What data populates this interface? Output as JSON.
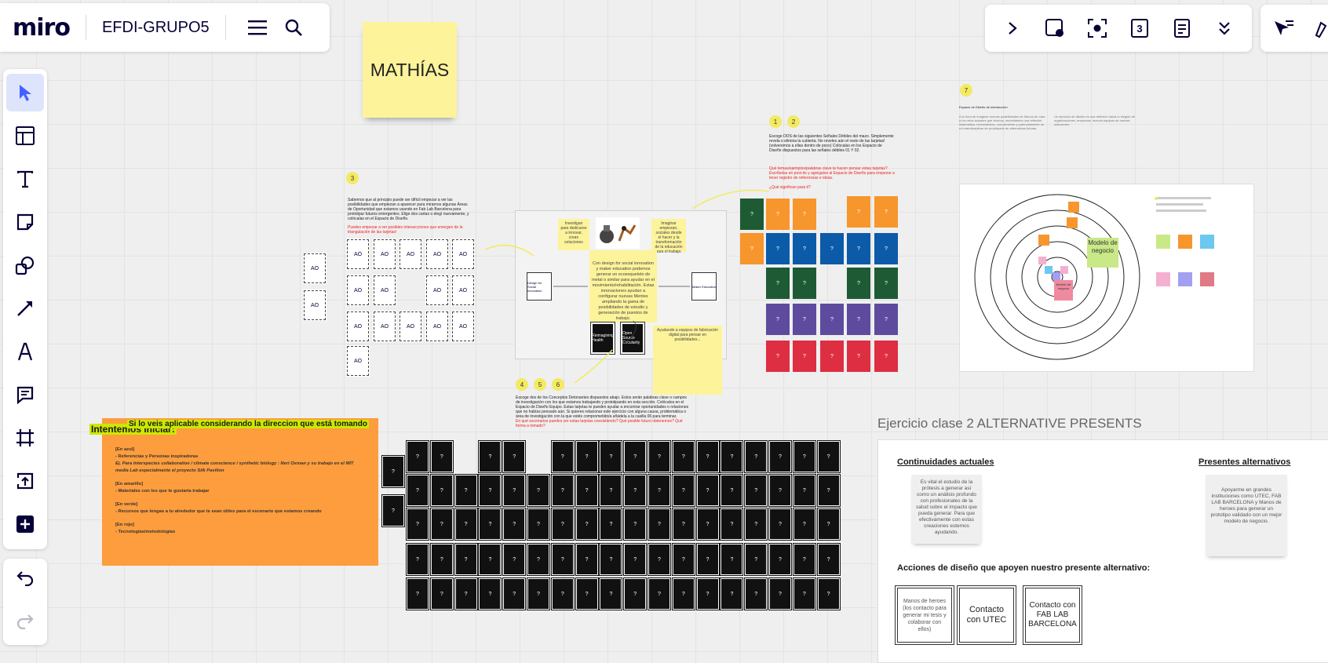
{
  "app": {
    "logo": "miro",
    "board_name": "EFDI-GRUPO5"
  },
  "topbar_right": {
    "icons": [
      "chevron-right-icon",
      "board-icon",
      "focus-icon",
      "timer-icon",
      "notes-icon",
      "chevron-double-down-icon"
    ],
    "timer_label": "3"
  },
  "toolbar": {
    "tools": [
      "select",
      "templates",
      "text",
      "sticky-note",
      "shapes",
      "line",
      "pen",
      "comment",
      "frame",
      "upload",
      "add"
    ]
  },
  "canvas": {
    "mathias": "MATHÍAS",
    "section3_num": "3",
    "section3_text": "Sabemos que al principio puede ser difícil empezar a ver las posibilidades que empiezan a aparecer para mirarnos algunas Áreas de Oportunidad que estamos usando en Fab Lab Barcelona para prototipar futuros emergentes. Elige dos cartas o elegí nuevamente, y colócalas en el Espacio de Diseño.",
    "section3_red": "Puedes empezar a ver posibles intersecciones que emergen de la triangulación de las tarjetas!",
    "ao_label": "AO",
    "center_sticky": "Con design for social innovation y maker education podemos generar un ecoesqueleto de metal o similar para ayudar en el movimiento/rehabilitación. Estas innovaciones ayudan a configurar nuevas Mentes ampliando la gama de posibilidades de estudio y generación de puestos de trabajo.",
    "center_left_sticky": "Investigan para dedicarse a innovar, crean soluciones",
    "center_right_sticky": "Imaginar empiezan, sociales desde el hacer y la transformación de la educación para el trabajo.",
    "center_bottom_sticky": "Ayudando a equipos de fabricación digital para pensar en posibilidades...",
    "card_left": "Design for Social Innovation",
    "card_right": "Maker Education",
    "card_black1": "Reimagining Health",
    "card_black2": "Open Source Circularity",
    "nums_12": [
      "1",
      "2"
    ],
    "section12_text": "Escoge DOS de las siguientes Señales Débiles del mazo. Simplemente revela o elimina la cubierta. No reveles aún el resto de las tarjetas! (volveremos a ellas dentro de poco) Colócalas en los Espacio de Diseño dispuestos para las señales débiles 01 Y 02.",
    "section12_red": "Qué temas/ejemplos/palabras clave te hacen pensar estas tarjetas? Escríbelas en post-its y agrégalos al Espacio de Diseño para empezar a tener registro de referencias e ideas.",
    "section12_red2": "¿Qué significan para ti?",
    "question_mark": "?",
    "section456_nums": [
      "4",
      "5",
      "6"
    ],
    "section456_text": "Escoge dos de los Conceptos Detonantes dispuestos abajo. Estos serán palabras clave o campos de investigación con los que estamos trabajando y prototipando en esta sección. Colócalos en el Espacio de Diseño Equipo. Estas tarjetas te pueden ayudar a encontrar oportunidades o relaciones que no habías pensado aún. Si quieres relacionar este ejercicio con alguna causa, problemática o área de investigación con la que estés comprometido/a añádela a la casilla 06 para terminar.",
    "section456_red": "En qué escenarios puedes ver estas tarjetas coexistiendo? Qué posible futuro obtenemos? Qué forma a tomado?",
    "section7_num": "7",
    "section7_heading": "Espacio de Diseño de Intersección",
    "section7_text": "A la hora de imaginar nuevas posibilidades de futuros de cara a los retos actuales que vivimos, necesitamos una reflexión sistemática, herramientas, conocimiento y potencialmente un rol interdisciplinar de prototipado de alternativas futuras.",
    "section7_text2": "Un ejercicio de diseño es una reflexión hacia lo elegido de organizaciones, empresas, nuevos equipos de nuevas soluciones.",
    "orange_title": "Intentemos iniciar:",
    "orange_highlight": "Si lo veis aplicable considerando la direccion que está tomando",
    "orange_lines": [
      "[En azul]",
      "- Referencias y Personas inspiradoras",
      "Ej. Para Interspecies collaboration / climate conscience / synthetic biology : Neri Oxman y su trabajo en el MIT media Lab especialmente el proyecto Silk Pavilion",
      "[En amarillo]",
      "- Materiales con los que te gustaría trabajar",
      "[En verde]",
      "- Recursos que tengas a tu alrededor que te sean útiles para el escenario que estamos creando",
      "[En rojo]",
      "- Tecnologías/metodologías"
    ],
    "circle_sticky": "Modelo de negocio",
    "circle_pink": "Modelo de negocio",
    "alt_title": "Ejercicio clase 2 ALTERNATIVE PRESENTS",
    "alt_continuidades": "Continuidades actuales",
    "alt_presentes": "Presentes alternativos",
    "alt_sticky1": "Es vital el estudio de la prótesis a generar así como un análisis profundo con profesionales de la salud sobre el impacto que pueda generar. Para que efectivamente con estas creaciones estemos ayudando.",
    "alt_sticky2": "Apoyarme en grandes instituciones como UTEC, FAB LAB BARCELONA y Manos de heroes para generar un prototipo validado con un mejor modelo de negocio.",
    "alt_acciones": "Acciones de diseño que apoyen nuestro presente alternativo:",
    "alt_box1": "Manos de heroes (los contacto para generar mi tesis y colaborar con ellos)",
    "alt_box2": "Contacto con UTEC",
    "alt_box3": "Contacto con FAB LAB BARCELONA"
  },
  "colors": {
    "orange": "#f7962d",
    "blue": "#0b5ba8",
    "green": "#1e5b35",
    "purple": "#5e4b9e",
    "red": "#de2e42",
    "yellow_sticky": "#fdf39b",
    "accent": "#4262ff"
  }
}
